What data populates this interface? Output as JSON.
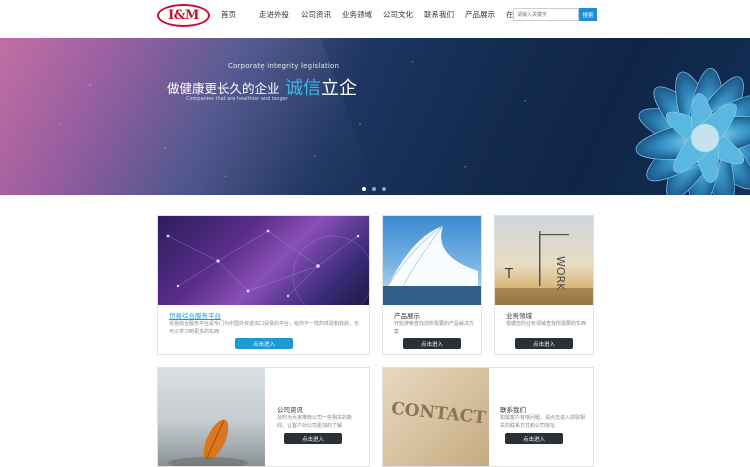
{
  "logo": {
    "text": "I&M"
  },
  "nav": [
    "首页",
    "走进外投",
    "公司资讯",
    "业务领域",
    "公司文化",
    "联系我们",
    "产品展示",
    "在线反馈"
  ],
  "search": {
    "placeholder": "请输入关键字",
    "button": "搜索"
  },
  "banner": {
    "small_title": "Corporate integrity legislation",
    "main_text": "做健康更长久的企业",
    "highlight_a": "诚信",
    "highlight_b": "立企",
    "subtitle": "Companies that are healthier and longer"
  },
  "cards": {
    "service": {
      "title": "贸易综合服务平台",
      "desc": "贸易综合服务平台是专门为中国外资进出口贸易的平台，给你不一样的体验和收获，也可以学习到更多的东西",
      "button": "点击进入"
    },
    "products": {
      "title": "产品展示",
      "desc": "开始搜索查找您所需要的产品解决方案",
      "button": "点击进入"
    },
    "business": {
      "title": "业务领域",
      "desc": "根据您的业务领域查找所需要的东西",
      "button": "点击进入"
    },
    "news": {
      "title": "公司资讯",
      "desc": "及时为大家推荐公司一些相关的新闻，让客户对公司更加的了解",
      "button": "点击进入"
    },
    "contact": {
      "title": "联系我们",
      "desc": "如需客户有啥问题，请点击进入获取相关的联系方式和公司地址",
      "button": "点击进入",
      "image_text": "CONTACT"
    }
  },
  "colors": {
    "accent": "#1b9ad6",
    "logo": "#c8102e",
    "dark_button": "#2b3036"
  }
}
